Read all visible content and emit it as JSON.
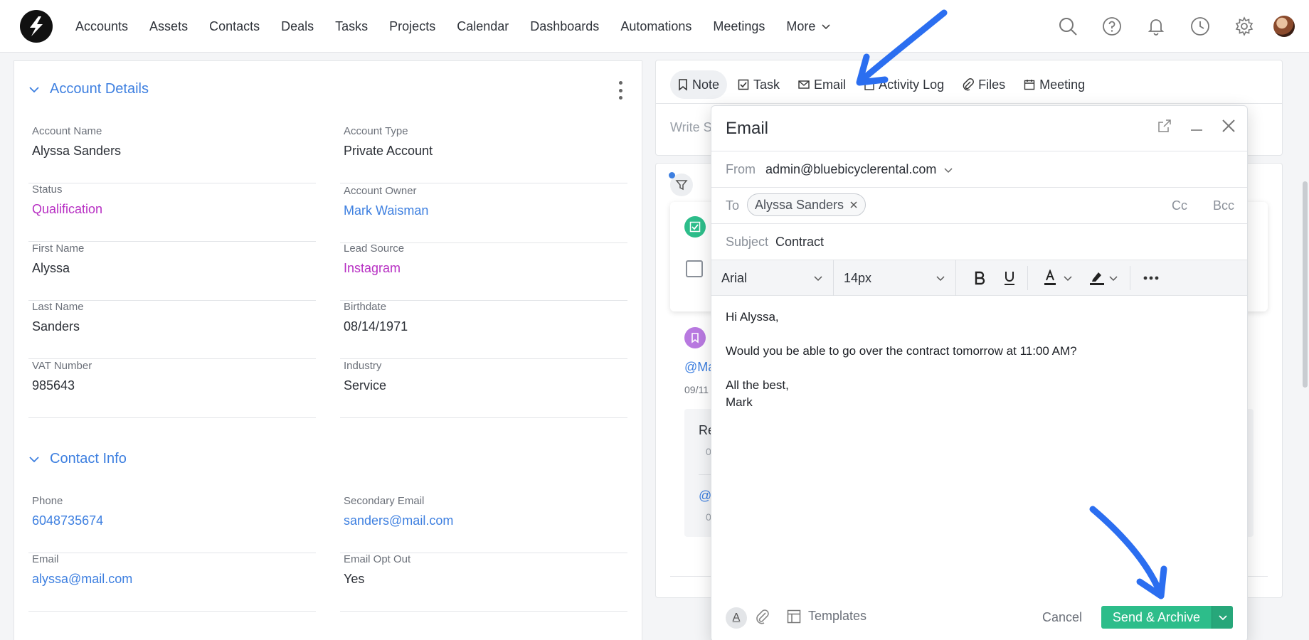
{
  "nav": {
    "items": [
      "Accounts",
      "Assets",
      "Contacts",
      "Deals",
      "Tasks",
      "Projects",
      "Calendar",
      "Dashboards",
      "Automations",
      "Meetings"
    ],
    "more_label": "More"
  },
  "account_details": {
    "title": "Account Details",
    "fields": [
      {
        "label": "Account Name",
        "value": "Alyssa Sanders"
      },
      {
        "label": "Account Type",
        "value": "Private Account"
      },
      {
        "label": "Status",
        "value": "Qualification"
      },
      {
        "label": "Account Owner",
        "value": "Mark Waisman"
      },
      {
        "label": "First Name",
        "value": "Alyssa"
      },
      {
        "label": "Lead Source",
        "value": "Instagram"
      },
      {
        "label": "Last Name",
        "value": "Sanders"
      },
      {
        "label": "Birthdate",
        "value": "08/14/1971"
      },
      {
        "label": "VAT Number",
        "value": "985643"
      },
      {
        "label": "Industry",
        "value": "Service"
      }
    ]
  },
  "contact_info": {
    "title": "Contact Info",
    "fields": [
      {
        "label": "Phone",
        "value": "6048735674"
      },
      {
        "label": "Secondary Email",
        "value": "sanders@mail.com"
      },
      {
        "label": "Email",
        "value": "alyssa@mail.com"
      },
      {
        "label": "Email Opt Out",
        "value": "Yes"
      }
    ]
  },
  "activity_tabs": {
    "note": "Note",
    "task": "Task",
    "email": "Email",
    "activity_log": "Activity Log",
    "files": "Files",
    "meeting": "Meeting",
    "write_placeholder": "Write S"
  },
  "feed": {
    "mention": "@Ma",
    "date": "09/11",
    "reply_title": "Re",
    "reply_sub1": "0",
    "reply_mention": "@",
    "reply_sub2": "0"
  },
  "email": {
    "title": "Email",
    "from_label": "From",
    "from_value": "admin@bluebicyclerental.com",
    "to_label": "To",
    "to_chip": "Alyssa Sanders",
    "cc": "Cc",
    "bcc": "Bcc",
    "subject_label": "Subject",
    "subject_value": "Contract",
    "font": "Arial",
    "size": "14px",
    "body": [
      "Hi Alyssa,",
      "",
      "Would you be able to go over the contract tomorrow at 11:00 AM?",
      "",
      "All the best,",
      "Mark"
    ],
    "templates": "Templates",
    "cancel": "Cancel",
    "send": "Send & Archive"
  },
  "colors": {
    "accent_blue": "#3d7fe0",
    "status_purple": "#b72fc3",
    "send_green": "#2dbd8a",
    "arrow_blue": "#2b6ef0"
  }
}
